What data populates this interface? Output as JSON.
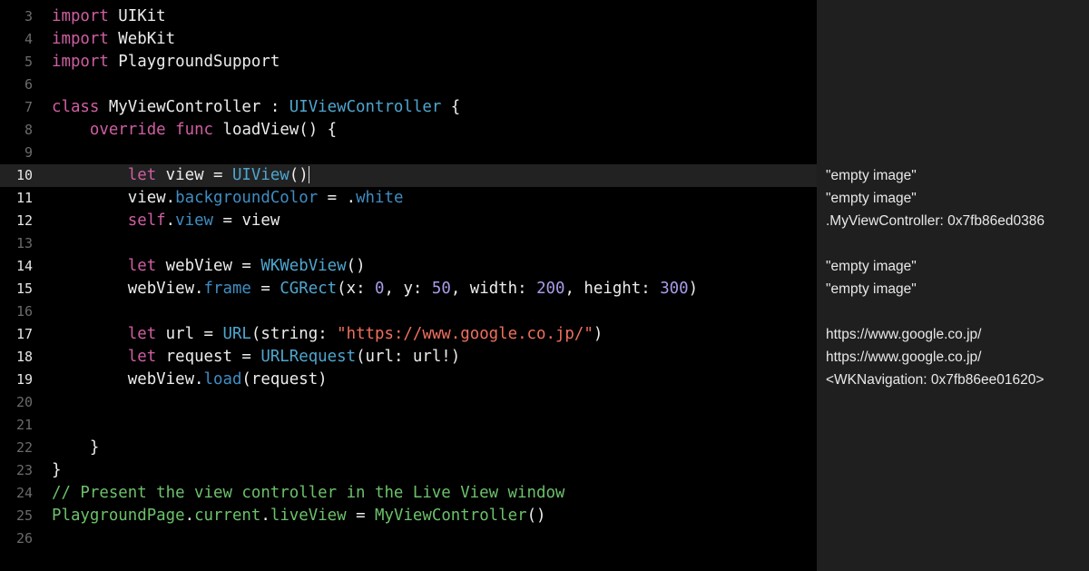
{
  "colors": {
    "keyword": "#cf5ea2",
    "type": "#4ea6cf",
    "property": "#3f8dc2",
    "string": "#f0705f",
    "number": "#a99be8",
    "comment": "#6cc16b",
    "editor_bg": "#000000",
    "results_bg": "#1f1f1f"
  },
  "current_line": 10,
  "lines": [
    {
      "n": "3",
      "t": [
        [
          "import",
          "kw"
        ],
        " UIKit"
      ]
    },
    {
      "n": "4",
      "t": [
        [
          "import",
          "kw"
        ],
        " WebKit"
      ]
    },
    {
      "n": "5",
      "t": [
        [
          "import",
          "kw"
        ],
        " PlaygroundSupport"
      ]
    },
    {
      "n": "6",
      "t": []
    },
    {
      "n": "7",
      "t": [
        [
          "class",
          "kw"
        ],
        " MyViewController : ",
        [
          "UIViewController",
          "ty"
        ],
        " {"
      ]
    },
    {
      "n": "8",
      "t": [
        "    ",
        [
          "override",
          "kw"
        ],
        " ",
        [
          "func",
          "kw"
        ],
        " loadView() {"
      ]
    },
    {
      "n": "9",
      "t": []
    },
    {
      "n": "10",
      "t": [
        "        ",
        [
          "let",
          "kw"
        ],
        " view = ",
        [
          "UIView",
          "ty"
        ],
        "()"
      ],
      "active": true,
      "result": "\"empty image\""
    },
    {
      "n": "11",
      "t": [
        "        view.",
        [
          "backgroundColor",
          "pr"
        ],
        " = .",
        [
          "white",
          "pr"
        ]
      ],
      "active": true,
      "result": "\"empty image\""
    },
    {
      "n": "12",
      "t": [
        "        ",
        [
          "self",
          "kw"
        ],
        ".",
        [
          "view",
          "pr"
        ],
        " = view"
      ],
      "active": true,
      "result": ".MyViewController: 0x7fb86ed0386"
    },
    {
      "n": "13",
      "t": []
    },
    {
      "n": "14",
      "t": [
        "        ",
        [
          "let",
          "kw"
        ],
        " webView = ",
        [
          "WKWebView",
          "ty"
        ],
        "()"
      ],
      "active": true,
      "result": "\"empty image\""
    },
    {
      "n": "15",
      "t": [
        "        webView.",
        [
          "frame",
          "pr"
        ],
        " = ",
        [
          "CGRect",
          "ty"
        ],
        "(x: ",
        [
          "0",
          "nu"
        ],
        ", y: ",
        [
          "50",
          "nu"
        ],
        ", width: ",
        [
          "200",
          "nu"
        ],
        ", height: ",
        [
          "300",
          "nu"
        ],
        ")"
      ],
      "active": true,
      "result": "\"empty image\""
    },
    {
      "n": "16",
      "t": []
    },
    {
      "n": "17",
      "t": [
        "        ",
        [
          "let",
          "kw"
        ],
        " url = ",
        [
          "URL",
          "ty"
        ],
        "(string: ",
        [
          "\"https://www.google.co.jp/\"",
          "st"
        ],
        ")"
      ],
      "active": true,
      "result": "https://www.google.co.jp/"
    },
    {
      "n": "18",
      "t": [
        "        ",
        [
          "let",
          "kw"
        ],
        " request = ",
        [
          "URLRequest",
          "ty"
        ],
        "(url: url!)"
      ],
      "active": true,
      "result": "https://www.google.co.jp/"
    },
    {
      "n": "19",
      "t": [
        "        webView.",
        [
          "load",
          "pr"
        ],
        "(request)"
      ],
      "active": true,
      "result": "<WKNavigation: 0x7fb86ee01620>"
    },
    {
      "n": "20",
      "t": []
    },
    {
      "n": "21",
      "t": []
    },
    {
      "n": "22",
      "t": [
        "    }"
      ]
    },
    {
      "n": "23",
      "t": [
        "}"
      ]
    },
    {
      "n": "24",
      "t": [
        [
          "// Present the view controller in the Live View window",
          "cm"
        ]
      ]
    },
    {
      "n": "25",
      "t": [
        [
          "PlaygroundPage",
          "gr"
        ],
        ".",
        [
          "current",
          "gr"
        ],
        ".",
        [
          "liveView",
          "gr"
        ],
        " = ",
        [
          "MyViewController",
          "gr"
        ],
        "()"
      ]
    },
    {
      "n": "26",
      "t": []
    }
  ]
}
